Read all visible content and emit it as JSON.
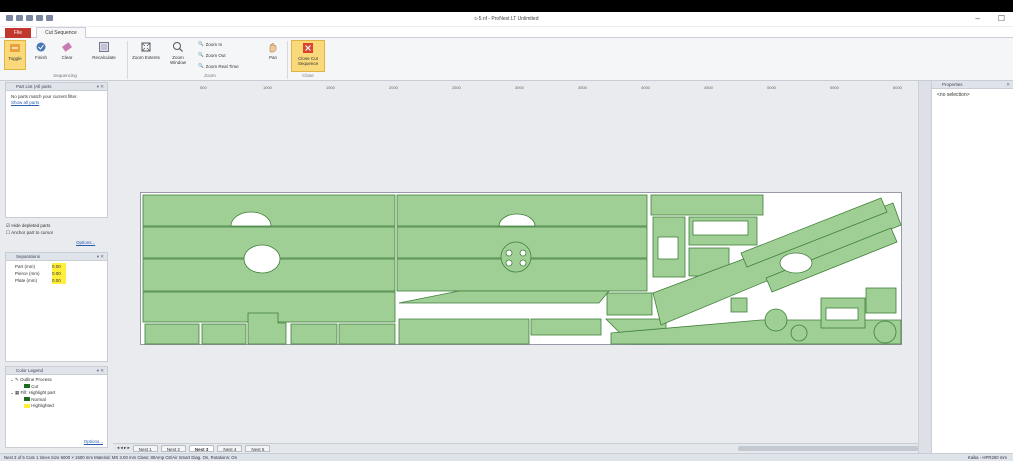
{
  "window": {
    "title": "c-5.nf - ProNest LT Unlimited",
    "controls": [
      "–",
      "☐",
      "✕"
    ]
  },
  "ribbon_tabs": {
    "file": "File",
    "active": "Cut Sequence"
  },
  "ribbon": {
    "toggle": "Toggle",
    "finish": "Finish",
    "clear": "Clear",
    "recalculate": "Recalculate",
    "zoom_extents": "Zoom Extents",
    "zoom_window": "Zoom Window",
    "zoom_in": "Zoom In",
    "zoom_out": "Zoom Out",
    "zoom_realtime": "Zoom Real Time",
    "pan": "Pan",
    "close_cut_sequence": "Close Cut Sequence",
    "group_sequencing": "Sequencing",
    "group_zoom": "Zoom",
    "group_close": "Close"
  },
  "part_list": {
    "title": "Part List (All parts",
    "empty_msg": "No parts match your current filter.",
    "show_all": "Show all parts",
    "hide_depleted": "Hide depleted parts",
    "anchor_part": "Anchor part to cursor",
    "options": "Options..."
  },
  "separations": {
    "title": "Separations",
    "rows": [
      {
        "label": "Part (mm)",
        "value": "0.00"
      },
      {
        "label": "Pierce (mm)",
        "value": "0.00"
      },
      {
        "label": "Plate (mm)",
        "value": "0.00"
      }
    ]
  },
  "color_legend": {
    "title": "Color Legend",
    "items": [
      {
        "label": "Outline Process",
        "level": 0
      },
      {
        "label": "Cut",
        "level": 1,
        "color": "#1d6b1d"
      },
      {
        "label": "Fill: Highlight part",
        "level": 0
      },
      {
        "label": "Normal",
        "level": 1,
        "color": "#1d6b1d"
      },
      {
        "label": "Highlighted",
        "level": 1,
        "color": "#ffef3a"
      }
    ],
    "options": "Options..."
  },
  "properties": {
    "title": "Properties",
    "selection": "<no selection>"
  },
  "ruler_ticks": [
    "500",
    "1000",
    "1500",
    "2000",
    "2500",
    "3000",
    "3500",
    "4000",
    "4500",
    "5000",
    "5500",
    "6000"
  ],
  "nest_tabs": [
    "Nest 1",
    "Nest 2",
    "Nest 3",
    "Nest 4",
    "Nest 5"
  ],
  "nest_tab_selected": "Nest 3",
  "status": {
    "text": "Nest 3 of 5   Cuts 1 times   Size 6000 × 1500 mm   Material: MS 3.00 mm   Class: 80Amp O2/Air   Smart Diag. On, Rotations: On",
    "right": "Kaika - HPR260 mm"
  },
  "colors": {
    "part_fill": "#9fcf94",
    "part_stroke": "#3f7f3a",
    "accent": "#c1362d"
  }
}
